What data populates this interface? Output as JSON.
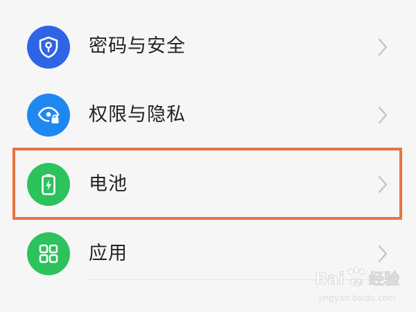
{
  "settings": {
    "items": [
      {
        "label": "密码与安全",
        "icon": "shield-keyhole-icon",
        "icon_color": "#2f64e6"
      },
      {
        "label": "权限与隐私",
        "icon": "eye-lock-icon",
        "icon_color": "#1e88f0"
      },
      {
        "label": "电池",
        "icon": "battery-charging-icon",
        "icon_color": "#2cc25c"
      },
      {
        "label": "应用",
        "icon": "apps-grid-icon",
        "icon_color": "#2cc25c"
      }
    ],
    "highlighted_item": "电池"
  },
  "watermark": {
    "brand": "Bai du 经验",
    "url": "jingyan.baidu.com"
  },
  "colors": {
    "background": "#f6f6f6",
    "highlight_border": "#e9733f",
    "chevron": "#c4c4c4",
    "text": "#222222"
  }
}
